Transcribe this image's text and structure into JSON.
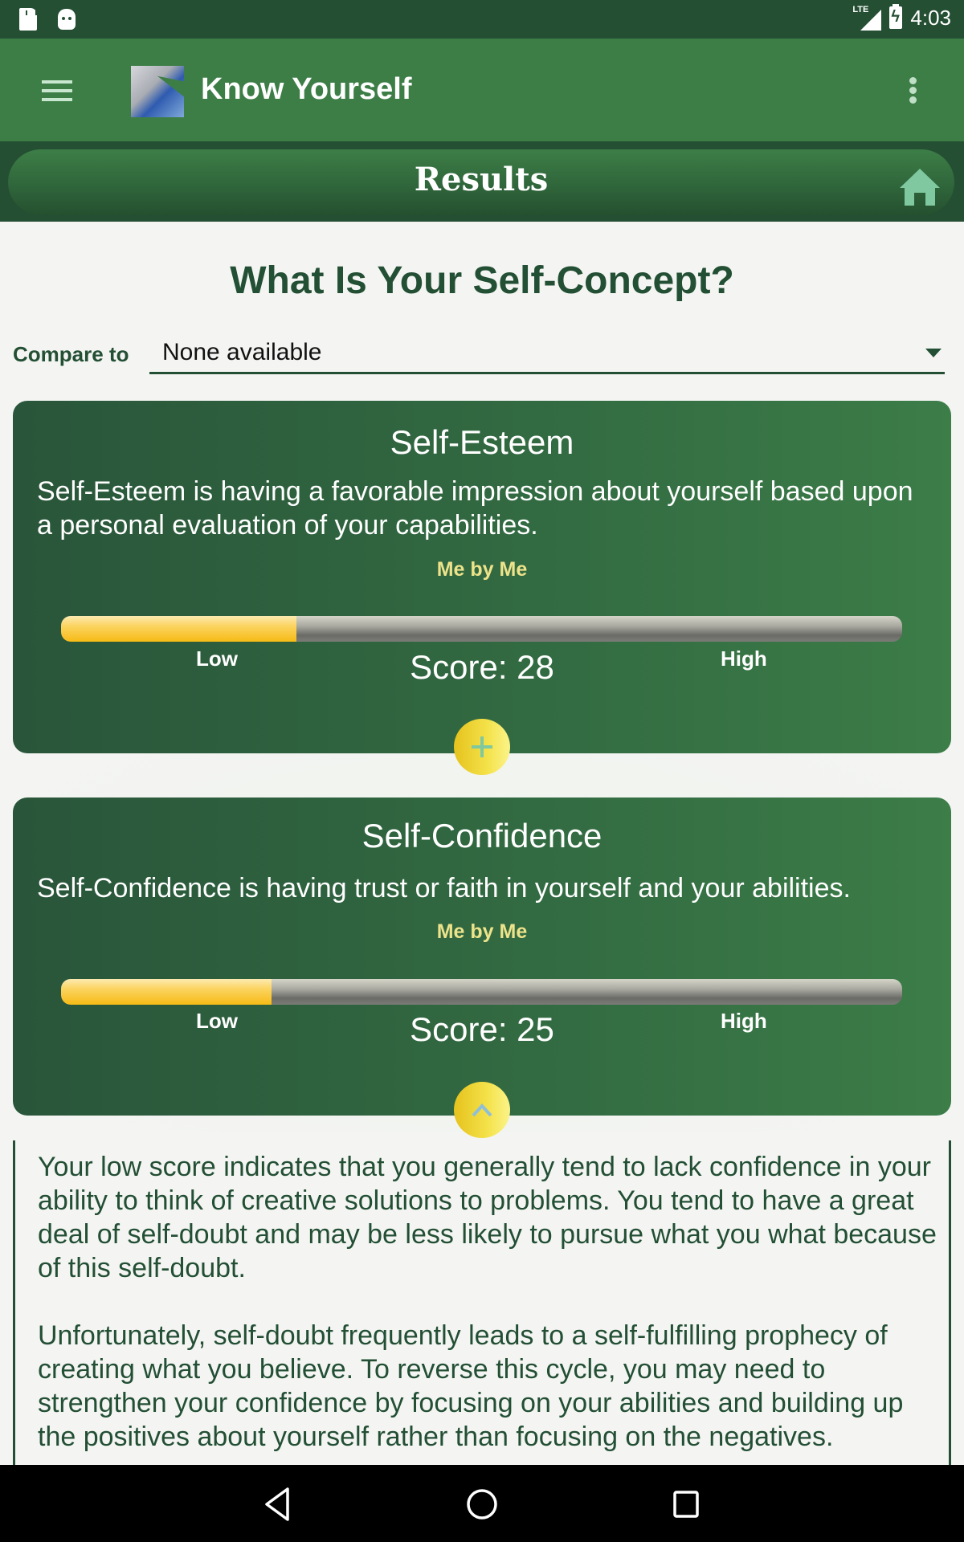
{
  "status_bar": {
    "time": "4:03",
    "network": "LTE",
    "icons": [
      "sd-card-icon",
      "android-icon",
      "lte-signal-icon",
      "battery-charging-icon"
    ]
  },
  "app_bar": {
    "title": "Know Yourself",
    "menu_icon": "hamburger-menu-icon",
    "overflow_icon": "more-vert-icon"
  },
  "header": {
    "title": "Results",
    "home_icon": "home-icon"
  },
  "page": {
    "title": "What Is Your Self-Concept?",
    "compare": {
      "label": "Compare to",
      "value": "None available"
    }
  },
  "cards": [
    {
      "title": "Self-Esteem",
      "description": "Self-Esteem is having a favorable impression about yourself based upon a personal evaluation of your capabilities.",
      "rater": "Me by Me",
      "score_label": "Score: 28",
      "score": 28,
      "score_max": 100,
      "low_label": "Low",
      "high_label": "High",
      "toggle_icon": "plus-icon"
    },
    {
      "title": "Self-Confidence",
      "description": "Self-Confidence is having trust or faith in yourself and your abilities.",
      "rater": "Me by Me",
      "score_label": "Score: 25",
      "score": 25,
      "score_max": 100,
      "low_label": "Low",
      "high_label": "High",
      "toggle_icon": "chevron-up-icon"
    }
  ],
  "detail": {
    "paragraphs": [
      "Your low score indicates that you generally tend to lack confidence in your ability to think of creative solutions to problems. You tend to have a great deal of self-doubt and may be less likely to pursue what you what because of this self-doubt.",
      "Unfortunately, self-doubt frequently leads to a self-fulfilling prophecy of creating what you believe. To reverse this cycle, you may need to strengthen your confidence by focusing on your abilities and building up the positives about yourself rather than focusing on the negatives."
    ]
  },
  "colors": {
    "status_bar": "#244f33",
    "app_bar": "#3d7e47",
    "heading_green": "#234f34",
    "rater_yellow": "#ede38a",
    "bar_fill": "#f6bb15",
    "home_icon": "#7fc8a0"
  },
  "nav_bar": {
    "buttons": [
      "back-icon",
      "home-circle-icon",
      "recents-icon"
    ]
  }
}
